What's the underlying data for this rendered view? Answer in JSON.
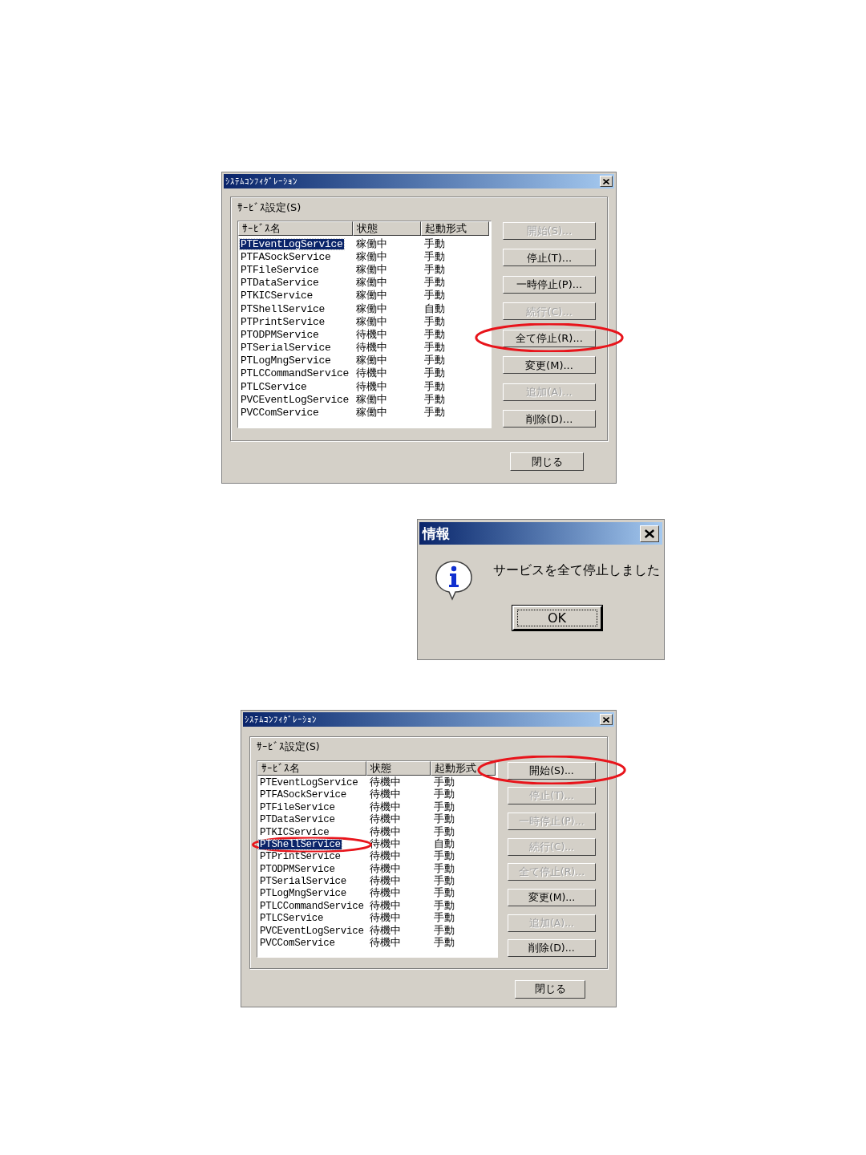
{
  "dialogs": [
    {
      "kind": "config",
      "title": "ｼｽﾃﾑｺﾝﾌｨｸﾞﾚｰｼｮﾝ",
      "group_label": "ｻｰﾋﾞｽ設定(S)",
      "columns": [
        "ｻｰﾋﾞｽ名",
        "状態",
        "起動形式"
      ],
      "rows": [
        {
          "name": "PTEventLogService",
          "status": "稼働中",
          "startup": "手動",
          "selected": true,
          "circled": false
        },
        {
          "name": "PTFASockService",
          "status": "稼働中",
          "startup": "手動",
          "selected": false,
          "circled": false
        },
        {
          "name": "PTFileService",
          "status": "稼働中",
          "startup": "手動",
          "selected": false,
          "circled": false
        },
        {
          "name": "PTDataService",
          "status": "稼働中",
          "startup": "手動",
          "selected": false,
          "circled": false
        },
        {
          "name": "PTKICService",
          "status": "稼働中",
          "startup": "手動",
          "selected": false,
          "circled": false
        },
        {
          "name": "PTShellService",
          "status": "稼働中",
          "startup": "自動",
          "selected": false,
          "circled": false
        },
        {
          "name": "PTPrintService",
          "status": "稼働中",
          "startup": "手動",
          "selected": false,
          "circled": false
        },
        {
          "name": "PTODPMService",
          "status": "待機中",
          "startup": "手動",
          "selected": false,
          "circled": false
        },
        {
          "name": "PTSerialService",
          "status": "待機中",
          "startup": "手動",
          "selected": false,
          "circled": false
        },
        {
          "name": "PTLogMngService",
          "status": "稼働中",
          "startup": "手動",
          "selected": false,
          "circled": false
        },
        {
          "name": "PTLCCommandService",
          "status": "待機中",
          "startup": "手動",
          "selected": false,
          "circled": false
        },
        {
          "name": "PTLCService",
          "status": "待機中",
          "startup": "手動",
          "selected": false,
          "circled": false
        },
        {
          "name": "PVCEventLogService",
          "status": "稼働中",
          "startup": "手動",
          "selected": false,
          "circled": false
        },
        {
          "name": "PVCComService",
          "status": "稼働中",
          "startup": "手動",
          "selected": false,
          "circled": false
        }
      ],
      "buttons": [
        {
          "label": "開始(S)...",
          "disabled": true,
          "circled": false
        },
        {
          "label": "停止(T)...",
          "disabled": false,
          "circled": false
        },
        {
          "label": "一時停止(P)...",
          "disabled": false,
          "circled": false
        },
        {
          "label": "続行(C)...",
          "disabled": true,
          "circled": false
        },
        {
          "label": "全て停止(R)...",
          "disabled": false,
          "circled": true
        },
        {
          "label": "変更(M)...",
          "disabled": false,
          "circled": false
        },
        {
          "label": "追加(A)...",
          "disabled": true,
          "circled": false
        },
        {
          "label": "削除(D)...",
          "disabled": false,
          "circled": false
        }
      ],
      "close_button": "閉じる"
    },
    {
      "kind": "message",
      "title": "情報",
      "message": "サービスを全て停止しました",
      "button": "OK"
    },
    {
      "kind": "config",
      "title": "ｼｽﾃﾑｺﾝﾌｨｸﾞﾚｰｼｮﾝ",
      "group_label": "ｻｰﾋﾞｽ設定(S)",
      "columns": [
        "ｻｰﾋﾞｽ名",
        "状態",
        "起動形式"
      ],
      "rows": [
        {
          "name": "PTEventLogService",
          "status": "待機中",
          "startup": "手動",
          "selected": false,
          "circled": false
        },
        {
          "name": "PTFASockService",
          "status": "待機中",
          "startup": "手動",
          "selected": false,
          "circled": false
        },
        {
          "name": "PTFileService",
          "status": "待機中",
          "startup": "手動",
          "selected": false,
          "circled": false
        },
        {
          "name": "PTDataService",
          "status": "待機中",
          "startup": "手動",
          "selected": false,
          "circled": false
        },
        {
          "name": "PTKICService",
          "status": "待機中",
          "startup": "手動",
          "selected": false,
          "circled": false
        },
        {
          "name": "PTShellService",
          "status": "待機中",
          "startup": "自動",
          "selected": true,
          "circled": true
        },
        {
          "name": "PTPrintService",
          "status": "待機中",
          "startup": "手動",
          "selected": false,
          "circled": false
        },
        {
          "name": "PTODPMService",
          "status": "待機中",
          "startup": "手動",
          "selected": false,
          "circled": false
        },
        {
          "name": "PTSerialService",
          "status": "待機中",
          "startup": "手動",
          "selected": false,
          "circled": false
        },
        {
          "name": "PTLogMngService",
          "status": "待機中",
          "startup": "手動",
          "selected": false,
          "circled": false
        },
        {
          "name": "PTLCCommandService",
          "status": "待機中",
          "startup": "手動",
          "selected": false,
          "circled": false
        },
        {
          "name": "PTLCService",
          "status": "待機中",
          "startup": "手動",
          "selected": false,
          "circled": false
        },
        {
          "name": "PVCEventLogService",
          "status": "待機中",
          "startup": "手動",
          "selected": false,
          "circled": false
        },
        {
          "name": "PVCComService",
          "status": "待機中",
          "startup": "手動",
          "selected": false,
          "circled": false
        }
      ],
      "buttons": [
        {
          "label": "開始(S)...",
          "disabled": false,
          "circled": true
        },
        {
          "label": "停止(T)...",
          "disabled": true,
          "circled": false
        },
        {
          "label": "一時停止(P)...",
          "disabled": true,
          "circled": false
        },
        {
          "label": "続行(C)...",
          "disabled": true,
          "circled": false
        },
        {
          "label": "全て停止(R)...",
          "disabled": true,
          "circled": false
        },
        {
          "label": "変更(M)...",
          "disabled": false,
          "circled": false
        },
        {
          "label": "追加(A)...",
          "disabled": true,
          "circled": false
        },
        {
          "label": "削除(D)...",
          "disabled": false,
          "circled": false
        }
      ],
      "close_button": "閉じる"
    }
  ]
}
